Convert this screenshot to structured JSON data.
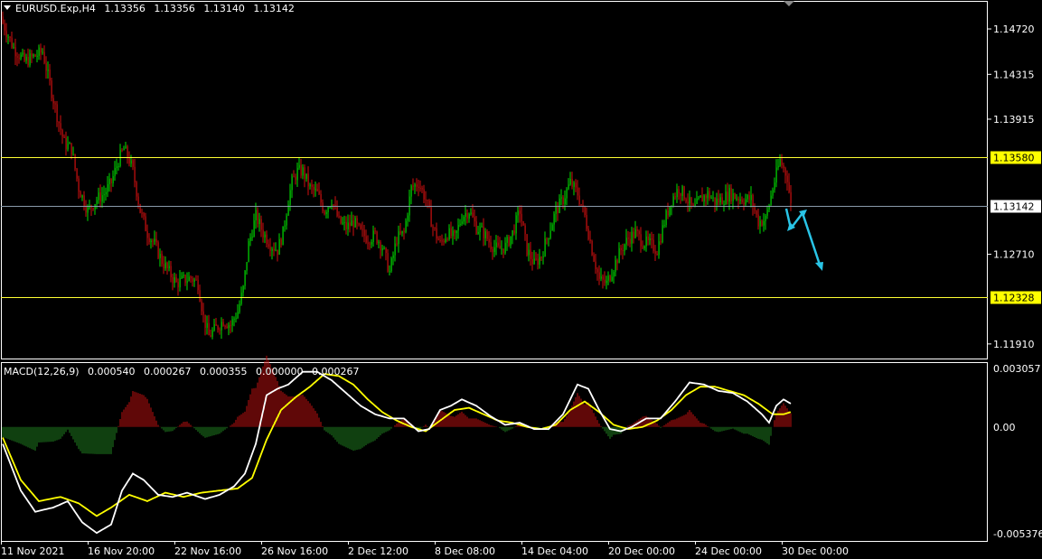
{
  "header": {
    "symbol": "EURUSD.Exp,H4",
    "open": "1.13356",
    "high": "1.13356",
    "low": "1.13140",
    "close": "1.13142"
  },
  "macd_header": {
    "title": "MACD(12,26,9)",
    "v1": "0.000540",
    "v2": "0.000267",
    "v3": "0.000355",
    "v4": "0.000000",
    "v5": "0.000267"
  },
  "colors": {
    "background": "#000000",
    "frame": "#ffffff",
    "bull": "#00e000",
    "bear": "#d01010",
    "level_line": "#ffff33",
    "current_line": "#8a9aaa",
    "label_bg": "#ffff00",
    "arrow": "#29c4e6",
    "macd_line": "#ffffff",
    "signal_line": "#ffff00",
    "hist_pos": "#c01010",
    "hist_neg": "#208020"
  },
  "chart_data": [
    {
      "type": "candlestick",
      "symbol": "EURUSD.Exp",
      "timeframe": "H4",
      "ylim": [
        1.1178,
        1.1497
      ],
      "y_ticks": [
        "1.14720",
        "1.14315",
        "1.13915",
        "1.13142",
        "1.12710",
        "1.11910"
      ],
      "x_ticks": [
        "11 Nov 2021",
        "16 Nov 20:00",
        "22 Nov 16:00",
        "26 Nov 16:00",
        "2 Dec 12:00",
        "8 Dec 08:00",
        "14 Dec 04:00",
        "20 Dec 00:00",
        "24 Dec 00:00",
        "30 Dec 00:00"
      ],
      "horizontal_levels": [
        {
          "value": 1.1358,
          "label": "1.13580"
        },
        {
          "value": 1.12328,
          "label": "1.12328"
        }
      ],
      "current_price": {
        "value": 1.13142,
        "label": "1.13142"
      },
      "close_path": [
        [
          0,
          1.1477
        ],
        [
          6,
          1.1455
        ],
        [
          12,
          1.1443
        ],
        [
          18,
          1.1448
        ],
        [
          22,
          1.1452
        ],
        [
          25,
          1.143
        ],
        [
          30,
          1.1395
        ],
        [
          34,
          1.137
        ],
        [
          38,
          1.1365
        ],
        [
          42,
          1.133
        ],
        [
          47,
          1.131
        ],
        [
          52,
          1.132
        ],
        [
          56,
          1.1325
        ],
        [
          60,
          1.1335
        ],
        [
          64,
          1.1355
        ],
        [
          67,
          1.1365
        ],
        [
          70,
          1.1355
        ],
        [
          72,
          1.1345
        ],
        [
          76,
          1.131
        ],
        [
          80,
          1.129
        ],
        [
          84,
          1.128
        ],
        [
          88,
          1.1265
        ],
        [
          92,
          1.1255
        ],
        [
          96,
          1.1245
        ],
        [
          100,
          1.1248
        ],
        [
          104,
          1.125
        ],
        [
          108,
          1.1245
        ],
        [
          111,
          1.1215
        ],
        [
          114,
          1.1198
        ],
        [
          118,
          1.1205
        ],
        [
          122,
          1.1212
        ],
        [
          126,
          1.1208
        ],
        [
          130,
          1.122
        ],
        [
          133,
          1.124
        ],
        [
          136,
          1.128
        ],
        [
          140,
          1.1305
        ],
        [
          144,
          1.129
        ],
        [
          148,
          1.128
        ],
        [
          152,
          1.1275
        ],
        [
          155,
          1.129
        ],
        [
          158,
          1.132
        ],
        [
          160,
          1.1335
        ],
        [
          163,
          1.1345
        ],
        [
          166,
          1.1345
        ],
        [
          170,
          1.133
        ],
        [
          174,
          1.1325
        ],
        [
          178,
          1.131
        ],
        [
          182,
          1.132
        ],
        [
          186,
          1.13
        ],
        [
          190,
          1.1295
        ],
        [
          194,
          1.13
        ],
        [
          198,
          1.129
        ],
        [
          202,
          1.1285
        ],
        [
          206,
          1.1288
        ],
        [
          210,
          1.1278
        ],
        [
          214,
          1.1255
        ],
        [
          218,
          1.1285
        ],
        [
          222,
          1.129
        ],
        [
          226,
          1.133
        ],
        [
          230,
          1.1335
        ],
        [
          234,
          1.132
        ],
        [
          238,
          1.1295
        ],
        [
          242,
          1.128
        ],
        [
          246,
          1.129
        ],
        [
          250,
          1.1285
        ],
        [
          254,
          1.1305
        ],
        [
          258,
          1.131
        ],
        [
          262,
          1.1295
        ],
        [
          266,
          1.129
        ],
        [
          270,
          1.128
        ],
        [
          274,
          1.1275
        ],
        [
          278,
          1.1278
        ],
        [
          282,
          1.129
        ],
        [
          286,
          1.131
        ],
        [
          290,
          1.1275
        ],
        [
          294,
          1.1262
        ],
        [
          298,
          1.127
        ],
        [
          302,
          1.129
        ],
        [
          306,
          1.131
        ],
        [
          310,
          1.132
        ],
        [
          314,
          1.1335
        ],
        [
          318,
          1.1325
        ],
        [
          322,
          1.1305
        ],
        [
          326,
          1.1275
        ],
        [
          330,
          1.1248
        ],
        [
          334,
          1.1245
        ],
        [
          338,
          1.126
        ],
        [
          342,
          1.1275
        ],
        [
          346,
          1.1285
        ],
        [
          350,
          1.129
        ],
        [
          354,
          1.1282
        ],
        [
          358,
          1.128
        ],
        [
          362,
          1.1275
        ],
        [
          366,
          1.13
        ],
        [
          370,
          1.132
        ],
        [
          374,
          1.133
        ],
        [
          378,
          1.1322
        ],
        [
          382,
          1.131
        ],
        [
          386,
          1.132
        ],
        [
          390,
          1.1325
        ],
        [
          394,
          1.1318
        ],
        [
          398,
          1.132
        ],
        [
          402,
          1.1325
        ],
        [
          406,
          1.1322
        ],
        [
          410,
          1.132
        ],
        [
          414,
          1.132
        ],
        [
          418,
          1.13
        ],
        [
          422,
          1.1302
        ],
        [
          426,
          1.133
        ],
        [
          430,
          1.1355
        ],
        [
          434,
          1.134
        ],
        [
          436,
          1.1314
        ]
      ]
    },
    {
      "type": "macd",
      "name": "MACD(12,26,9)",
      "ylim": [
        -0.005376,
        0.003057
      ],
      "y_ticks": [
        "0.003057",
        "0.00",
        "-0.005376"
      ],
      "macd_path": [
        [
          0,
          -0.0008
        ],
        [
          10,
          -0.003
        ],
        [
          18,
          -0.004
        ],
        [
          28,
          -0.0038
        ],
        [
          36,
          -0.0035
        ],
        [
          44,
          -0.0045
        ],
        [
          52,
          -0.005
        ],
        [
          60,
          -0.0046
        ],
        [
          66,
          -0.003
        ],
        [
          72,
          -0.0022
        ],
        [
          78,
          -0.0025
        ],
        [
          86,
          -0.0032
        ],
        [
          94,
          -0.0033
        ],
        [
          102,
          -0.0031
        ],
        [
          112,
          -0.0034
        ],
        [
          120,
          -0.0032
        ],
        [
          128,
          -0.0028
        ],
        [
          134,
          -0.0022
        ],
        [
          140,
          -0.0008
        ],
        [
          146,
          0.0015
        ],
        [
          152,
          0.0018
        ],
        [
          158,
          0.002
        ],
        [
          166,
          0.0026
        ],
        [
          174,
          0.0026
        ],
        [
          182,
          0.0022
        ],
        [
          190,
          0.0016
        ],
        [
          198,
          0.001
        ],
        [
          206,
          0.0006
        ],
        [
          214,
          0.0004
        ],
        [
          222,
          0.0004
        ],
        [
          230,
          -0.0002
        ],
        [
          236,
          -0.0001
        ],
        [
          242,
          0.0008
        ],
        [
          248,
          0.001
        ],
        [
          254,
          0.0013
        ],
        [
          262,
          0.001
        ],
        [
          270,
          0.0005
        ],
        [
          278,
          0.0001
        ],
        [
          286,
          0.0002
        ],
        [
          294,
          -0.0001
        ],
        [
          302,
          -0.0001
        ],
        [
          310,
          0.0006
        ],
        [
          318,
          0.002
        ],
        [
          324,
          0.0018
        ],
        [
          330,
          0.0008
        ],
        [
          336,
          -0.0001
        ],
        [
          342,
          -0.0002
        ],
        [
          348,
          0.0
        ],
        [
          356,
          0.0004
        ],
        [
          364,
          0.0004
        ],
        [
          372,
          0.0012
        ],
        [
          380,
          0.0021
        ],
        [
          388,
          0.002
        ],
        [
          396,
          0.0017
        ],
        [
          404,
          0.0016
        ],
        [
          412,
          0.0012
        ],
        [
          420,
          0.0006
        ],
        [
          424,
          0.0002
        ],
        [
          428,
          0.001
        ],
        [
          432,
          0.0013
        ],
        [
          436,
          0.0011
        ]
      ],
      "signal_path": [
        [
          0,
          -0.0005
        ],
        [
          10,
          -0.0025
        ],
        [
          20,
          -0.0035
        ],
        [
          32,
          -0.0033
        ],
        [
          42,
          -0.0036
        ],
        [
          52,
          -0.0042
        ],
        [
          60,
          -0.0038
        ],
        [
          70,
          -0.0032
        ],
        [
          80,
          -0.0035
        ],
        [
          90,
          -0.0031
        ],
        [
          100,
          -0.0033
        ],
        [
          110,
          -0.0031
        ],
        [
          120,
          -0.003
        ],
        [
          130,
          -0.0029
        ],
        [
          138,
          -0.0024
        ],
        [
          146,
          -0.0006
        ],
        [
          154,
          0.0008
        ],
        [
          162,
          0.0014
        ],
        [
          170,
          0.0019
        ],
        [
          178,
          0.0025
        ],
        [
          186,
          0.0024
        ],
        [
          194,
          0.002
        ],
        [
          202,
          0.0013
        ],
        [
          210,
          0.0007
        ],
        [
          218,
          0.0003
        ],
        [
          226,
          0.0
        ],
        [
          234,
          -0.0002
        ],
        [
          242,
          0.0003
        ],
        [
          250,
          0.0008
        ],
        [
          258,
          0.0009
        ],
        [
          266,
          0.0006
        ],
        [
          274,
          0.0003
        ],
        [
          282,
          0.0002
        ],
        [
          290,
          0.0
        ],
        [
          298,
          -0.0001
        ],
        [
          306,
          0.0001
        ],
        [
          314,
          0.0008
        ],
        [
          322,
          0.0012
        ],
        [
          330,
          0.0007
        ],
        [
          338,
          0.0001
        ],
        [
          346,
          -0.0001
        ],
        [
          354,
          0.0
        ],
        [
          362,
          0.0003
        ],
        [
          370,
          0.0008
        ],
        [
          378,
          0.0015
        ],
        [
          386,
          0.0019
        ],
        [
          394,
          0.0019
        ],
        [
          402,
          0.0017
        ],
        [
          410,
          0.0015
        ],
        [
          418,
          0.0011
        ],
        [
          426,
          0.0006
        ],
        [
          432,
          0.0006
        ],
        [
          436,
          0.0007
        ]
      ]
    }
  ]
}
